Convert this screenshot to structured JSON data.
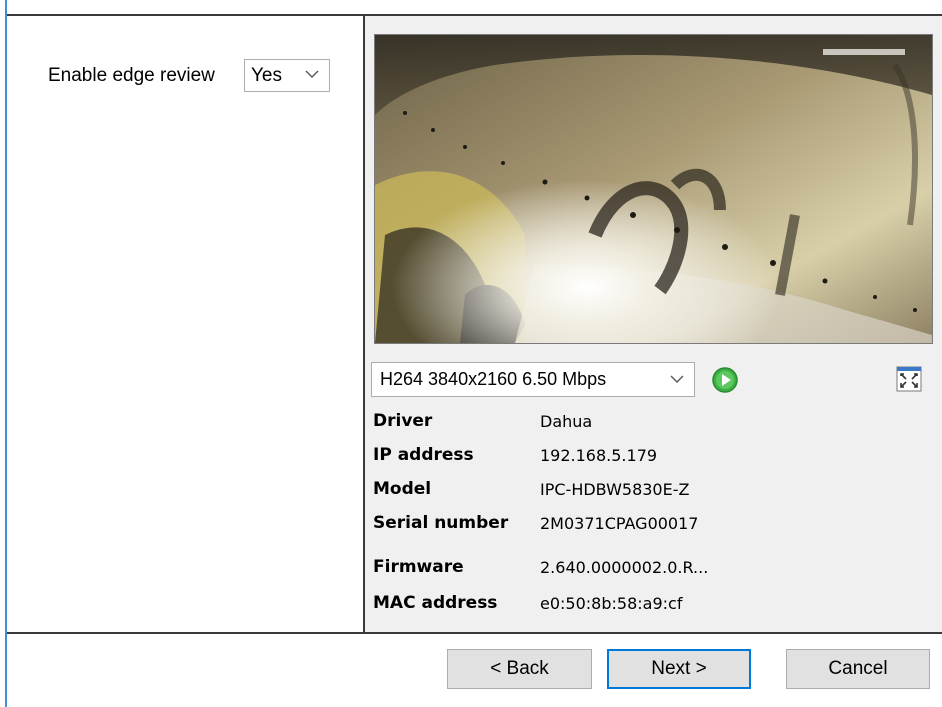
{
  "edge_review": {
    "label": "Enable edge review",
    "value": "Yes"
  },
  "stream": {
    "selected": "H264 3840x2160 6.50 Mbps"
  },
  "info": [
    {
      "key": "Driver",
      "value": "Dahua"
    },
    {
      "key": "IP address",
      "value": "192.168.5.179"
    },
    {
      "key": "Model",
      "value": "IPC-HDBW5830E-Z"
    },
    {
      "key": "Serial number",
      "value": "2M0371CPAG00017"
    },
    {
      "key": "Firmware",
      "value": "2.640.0000002.0.R..."
    },
    {
      "key": "MAC address",
      "value": "e0:50:8b:58:a9:cf"
    }
  ],
  "buttons": {
    "back": "< Back",
    "next": "Next >",
    "cancel": "Cancel"
  },
  "icons": {
    "play": "play-icon",
    "fullscreen": "fullscreen-icon",
    "dropdown": "chevron-down-icon"
  },
  "colors": {
    "accent": "#0078d7",
    "play_green": "#3cb043",
    "panel_bg": "#f0f0f0"
  }
}
